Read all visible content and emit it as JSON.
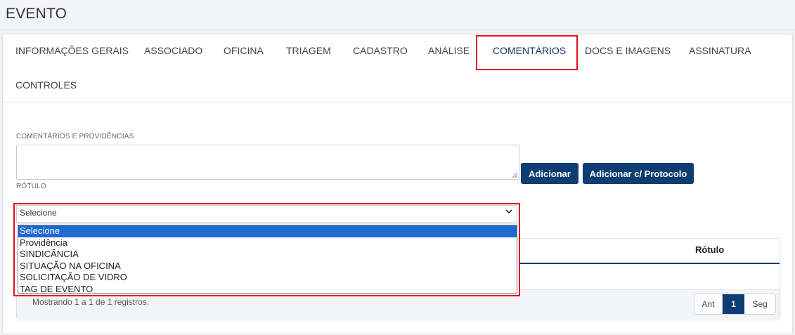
{
  "page": {
    "title": "EVENTO"
  },
  "tabs": [
    {
      "label": "INFORMAÇÕES GERAIS"
    },
    {
      "label": "ASSOCIADO"
    },
    {
      "label": "OFICINA"
    },
    {
      "label": "TRIAGEM"
    },
    {
      "label": "CADASTRO"
    },
    {
      "label": "ANÁLISE"
    },
    {
      "label": "COMENTÁRIOS",
      "active": true
    },
    {
      "label": "DOCS E IMAGENS"
    },
    {
      "label": "ASSINATURA"
    },
    {
      "label": "CONTROLES"
    }
  ],
  "form": {
    "comments_label": "COMENTÁRIOS E PROVIDÊNCIAS",
    "comments_value": "",
    "add_button": "Adicionar",
    "add_protocol_button": "Adicionar c/ Protocolo",
    "label_field_label": "RÓTULO",
    "label_select_value": "Selecione",
    "label_options": [
      "Selecione",
      "Providência",
      "SINDICÂNCIA",
      "SITUAÇÃO NA OFICINA",
      "SOLICITAÇÃO DE VIDRO",
      "TAG DE EVENTO"
    ]
  },
  "table": {
    "column_header": "Rótulo",
    "footer_info": "Mostrando 1 a 1 de 1 registros.",
    "pager": {
      "prev": "Ant",
      "current": "1",
      "next": "Seg"
    }
  },
  "colors": {
    "primary": "#0d3d73",
    "highlight": "#e0141e",
    "option_selected": "#1f69d0"
  },
  "icons": {
    "select_arrow": "chevron-down-icon",
    "resize": "resize-grip-icon"
  }
}
